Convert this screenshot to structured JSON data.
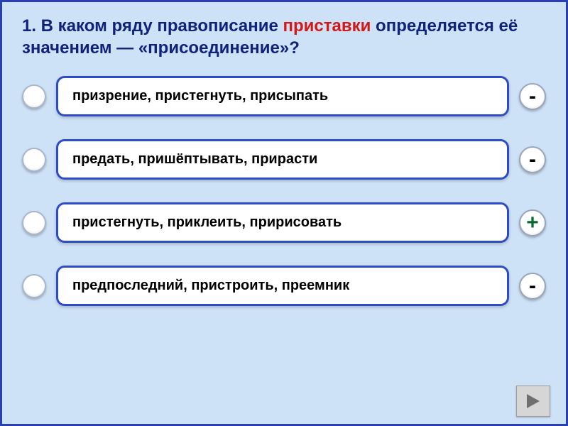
{
  "question": {
    "prefix": "1. В каком ряду правописание ",
    "highlight": "приставки",
    "suffix": " определяется её значением — «присоединение»?"
  },
  "options": [
    {
      "text": "призрение, пристегнуть, присыпать",
      "mark": "-",
      "mark_type": "minus"
    },
    {
      "text": "предать, пришёптывать, прирасти",
      "mark": "-",
      "mark_type": "minus"
    },
    {
      "text": "пристегнуть, приклеить, пририсовать",
      "mark": "+",
      "mark_type": "plus"
    },
    {
      "text": "предпоследний, пристроить, преемник",
      "mark": "-",
      "mark_type": "minus"
    }
  ]
}
